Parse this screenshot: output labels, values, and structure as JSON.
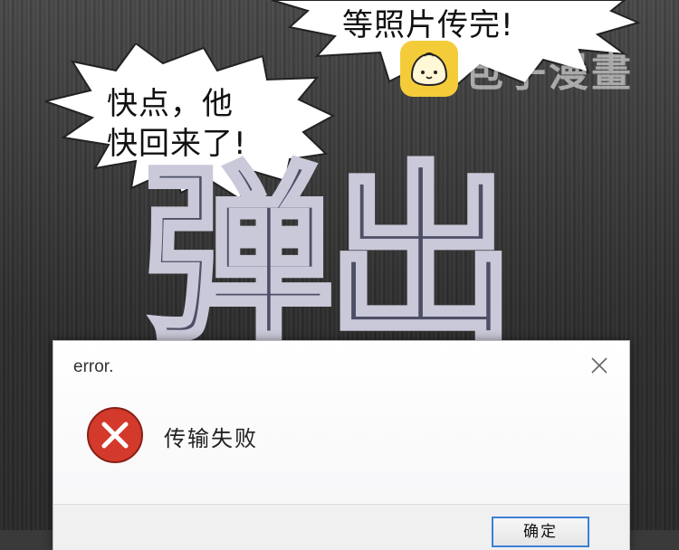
{
  "speech": {
    "bubble_left_line1": "快点，他",
    "bubble_left_line2": "快回来了!",
    "bubble_top": "等照片传完!"
  },
  "watermark": {
    "brand": "包子漫畫",
    "icon": "bun-logo-icon",
    "color": "#f4cc3a"
  },
  "big_text": "弹出",
  "dialog": {
    "title": "error.",
    "close_icon": "close-icon",
    "error_icon": "error-x-icon",
    "error_color": "#d33a2c",
    "message": "传输失败",
    "ok_label": "确定"
  }
}
